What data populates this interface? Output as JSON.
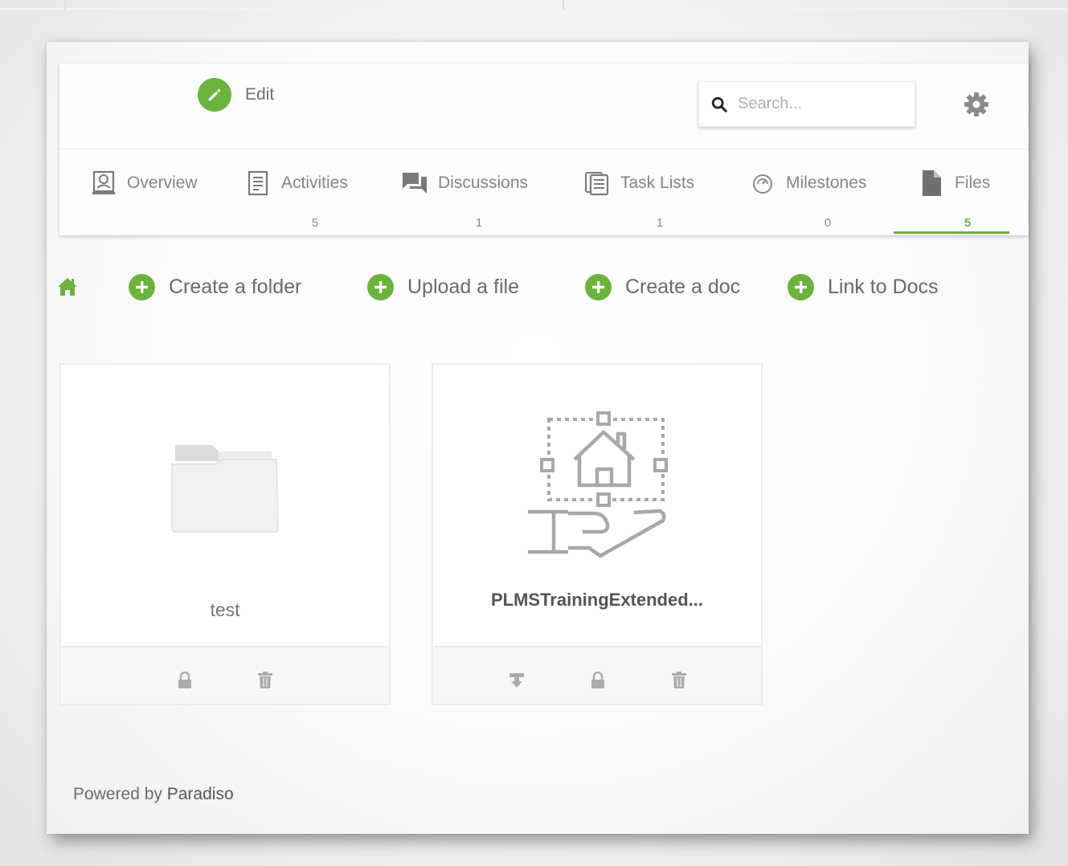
{
  "header": {
    "edit_label": "Edit",
    "search_placeholder": "Search..."
  },
  "tabs": [
    {
      "label": "Overview",
      "count": "",
      "icon": "overview-icon"
    },
    {
      "label": "Activities",
      "count": "5",
      "icon": "activities-icon"
    },
    {
      "label": "Discussions",
      "count": "1",
      "icon": "discussions-icon"
    },
    {
      "label": "Task Lists",
      "count": "1",
      "icon": "task-lists-icon"
    },
    {
      "label": "Milestones",
      "count": "0",
      "icon": "milestones-icon"
    },
    {
      "label": "Files",
      "count": "5",
      "icon": "files-icon",
      "active": true
    }
  ],
  "actions": {
    "create_folder": "Create a folder",
    "upload_file": "Upload a file",
    "create_doc": "Create a doc",
    "link_docs": "Link to Docs"
  },
  "files": [
    {
      "name": "test",
      "type": "folder",
      "icon": "folder-icon"
    },
    {
      "name": "PLMSTrainingExtended...",
      "type": "file",
      "icon": "house-in-hand-icon"
    }
  ],
  "footer": {
    "powered_prefix": "Powered by",
    "brand": "Paradiso"
  },
  "colors": {
    "accent": "#6bb33c",
    "text": "#6a6a6a",
    "icon_gray": "#a8a8a8"
  }
}
